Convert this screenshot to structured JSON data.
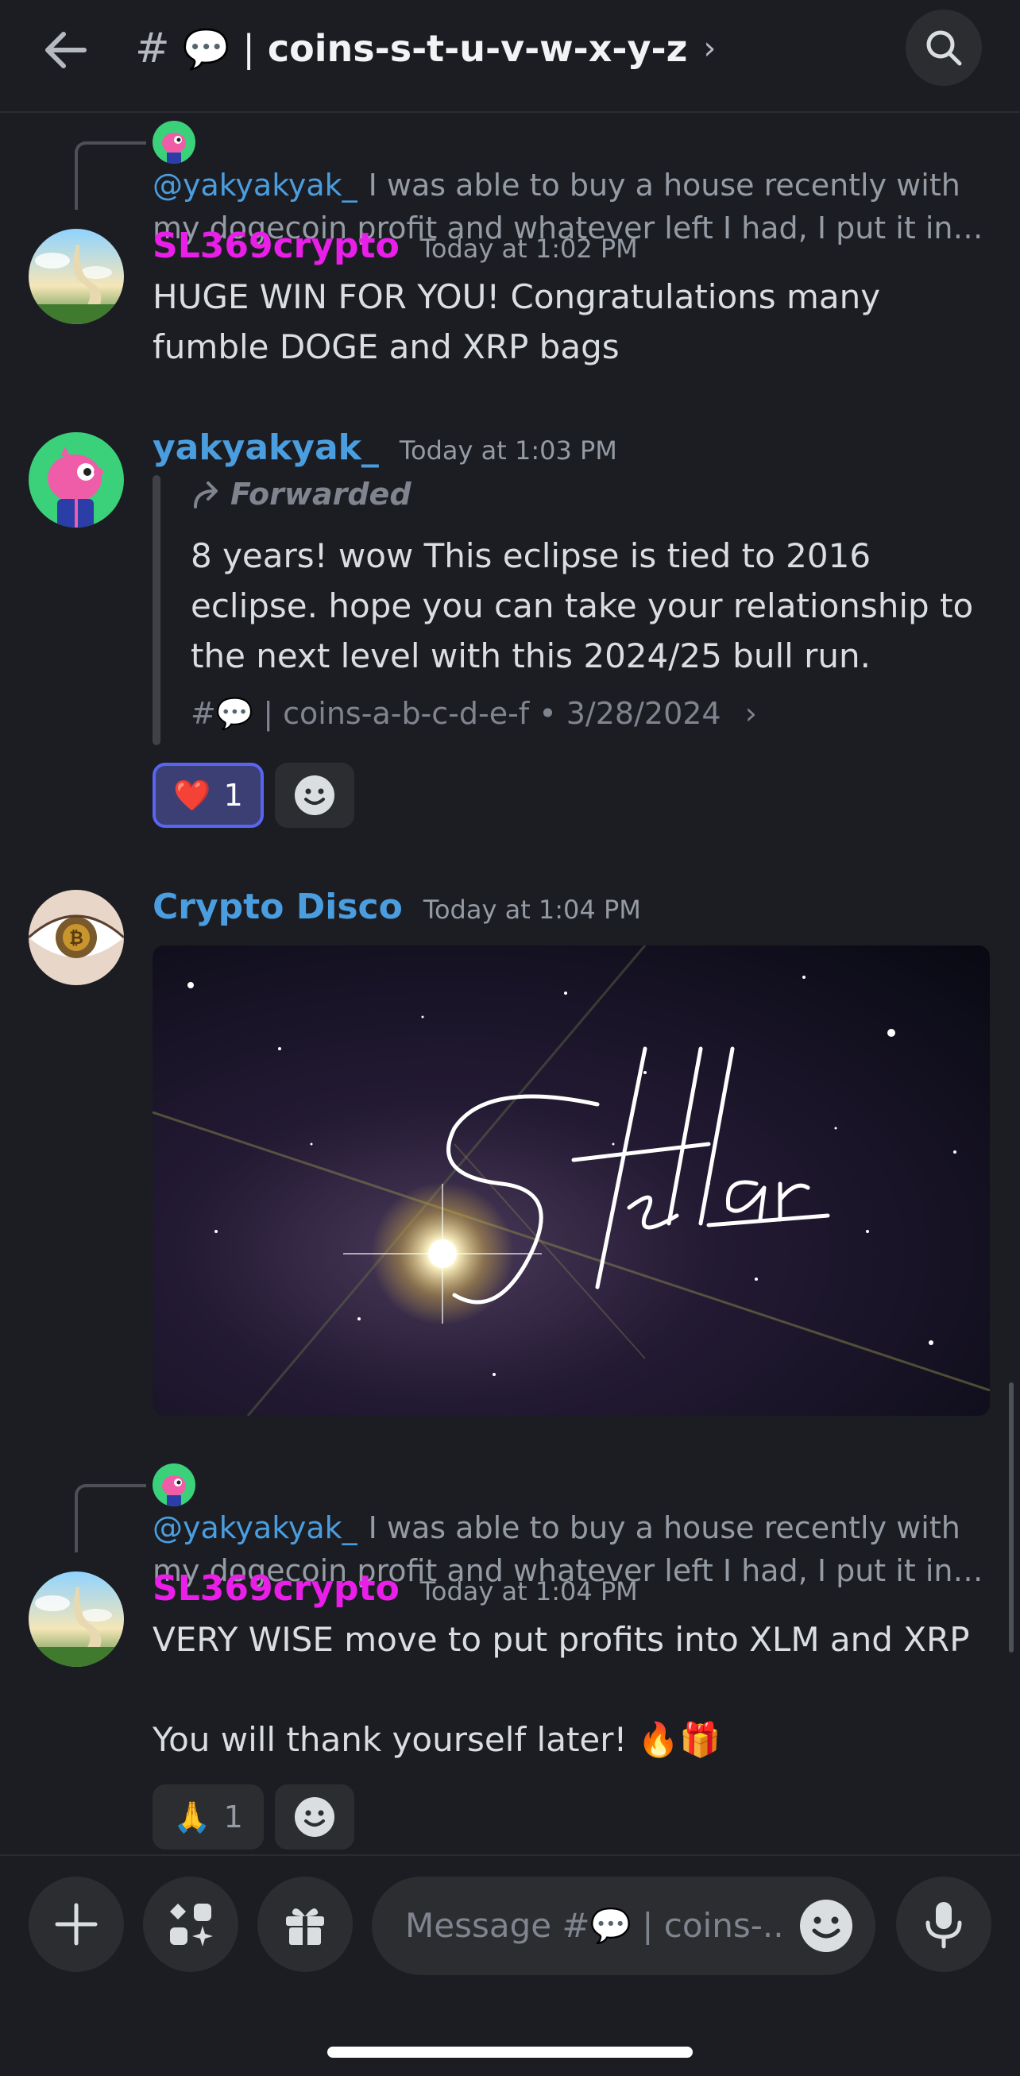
{
  "header": {
    "hash": "#",
    "channel_emoji": "💬",
    "separator": "|",
    "channel_name": "coins-s-t-u-v-w-x-y-z",
    "chevron": "›"
  },
  "messages": [
    {
      "reply": {
        "mention": "@yakyakyak_",
        "preview_line1": "I was able to buy a house recently with",
        "preview_line2": "my dogecoin profit and whatever left I had, I put it into xr..."
      },
      "author": "SL369crypto",
      "author_color": "#e91ee8",
      "timestamp": "Today at 1:02 PM",
      "text": "HUGE WIN FOR YOU! Congratulations many fumble DOGE and XRP bags"
    },
    {
      "author": "yakyakyak_",
      "author_color": "#4a9ee0",
      "timestamp": "Today at 1:03 PM",
      "forwarded": {
        "label": "Forwarded",
        "text": "8 years! wow This eclipse is tied to 2016 eclipse. hope you can take your relationship to the next level with this 2024/25 bull run.",
        "source_hash": "#",
        "source_emoji": "💬",
        "source_channel": "| coins-a-b-c-d-e-f • 3/28/2024",
        "source_chevron": "›"
      },
      "reaction": {
        "emoji": "❤️",
        "count": "1"
      }
    },
    {
      "author": "Crypto Disco",
      "author_color": "#4a9ee0",
      "timestamp": "Today at 1:04 PM",
      "image_text": "Stellar"
    },
    {
      "reply": {
        "mention": "@yakyakyak_",
        "preview_line1": "I was able to buy a house recently with",
        "preview_line2": "my dogecoin profit and whatever left I had, I put it into xr..."
      },
      "author": "SL369crypto",
      "author_color": "#e91ee8",
      "timestamp": "Today at 1:04 PM",
      "text_line1": "VERY WISE move to put profits into XLM and XRP",
      "text_line2": "You will thank yourself later! 🔥🎁",
      "reaction": {
        "emoji": "🙏",
        "count": "1"
      }
    }
  ],
  "composer": {
    "placeholder": "Message #💬 | coins-..",
    "buttons": [
      "plus-icon",
      "apps-icon",
      "gift-icon"
    ],
    "right_button": "microphone-icon"
  },
  "colors": {
    "background": "#1c1d22",
    "surface": "#2b2d31",
    "accent": "#5865f2",
    "link": "#4a9ee0",
    "muted": "#949ba4"
  }
}
